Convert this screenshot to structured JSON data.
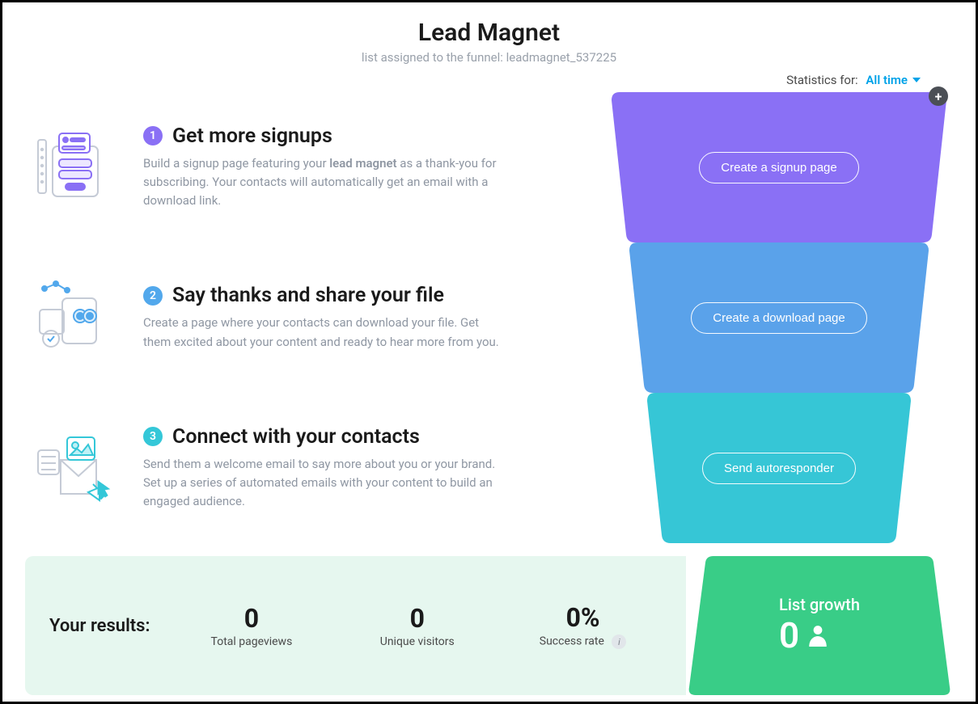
{
  "header": {
    "title": "Lead Magnet",
    "subtitle_prefix": "list assigned to the funnel: ",
    "list_name": "leadmagnet_537225"
  },
  "statistics": {
    "label": "Statistics for:",
    "range": "All time"
  },
  "steps": [
    {
      "number": "1",
      "title": "Get more signups",
      "desc_before_bold": "Build a signup page featuring your ",
      "desc_bold": "lead magnet",
      "desc_after_bold": " as a thank-you for subscribing. Your contacts will automatically get an email with a download link.",
      "cta": "Create a signup page",
      "color": "#8a70f5"
    },
    {
      "number": "2",
      "title": "Say thanks and share your file",
      "desc": "Create a page where your contacts can download your file. Get them excited about your content and ready to hear more from you.",
      "cta": "Create a download page",
      "color": "#5aa2ea"
    },
    {
      "number": "3",
      "title": "Connect with your contacts",
      "desc": "Send them a welcome email to say more about you or your brand. Set up a series of automated emails with your content to build an engaged audience.",
      "cta": "Send autoresponder",
      "color": "#36c6d6"
    }
  ],
  "results": {
    "title": "Your results:",
    "metrics": [
      {
        "value": "0",
        "label": "Total pageviews"
      },
      {
        "value": "0",
        "label": "Unique visitors"
      },
      {
        "value": "0%",
        "label": "Success rate"
      }
    ],
    "list_growth": {
      "title": "List growth",
      "value": "0",
      "color": "#39cd87"
    }
  }
}
